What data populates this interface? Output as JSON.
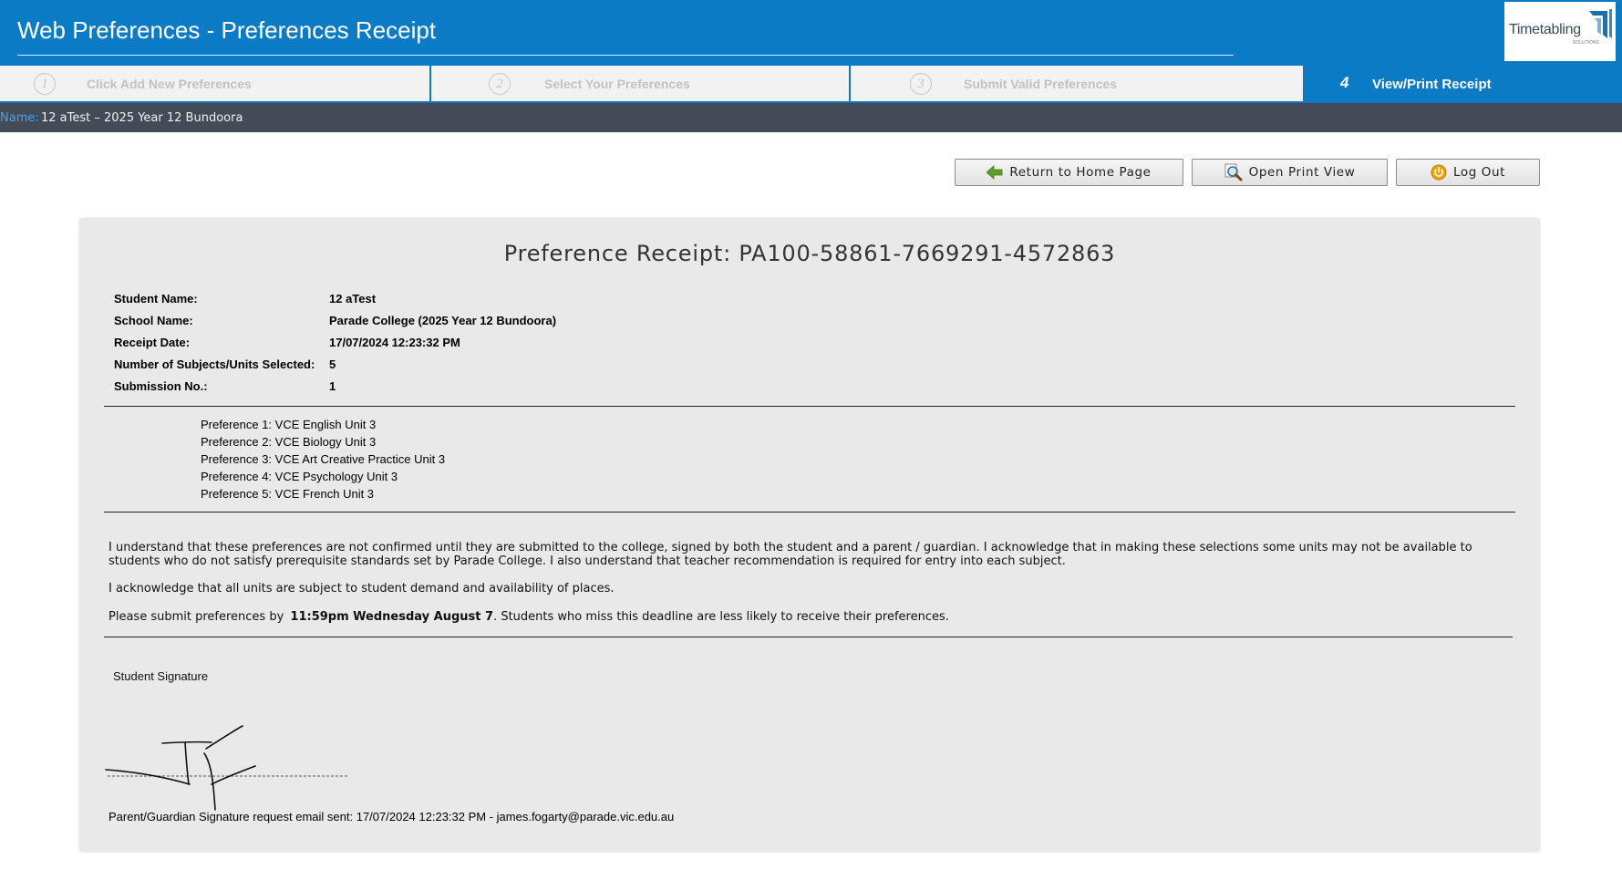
{
  "header": {
    "title": "Web Preferences - Preferences Receipt",
    "logo_text": "Timetabling",
    "logo_sub": "SOLUTIONS"
  },
  "steps": [
    {
      "number": "1",
      "label": "Click Add New Preferences",
      "active": false
    },
    {
      "number": "2",
      "label": "Select Your Preferences",
      "active": false
    },
    {
      "number": "3",
      "label": "Submit Valid Preferences",
      "active": false
    },
    {
      "number": "4",
      "label": "View/Print Receipt",
      "active": true
    }
  ],
  "namebar": {
    "label": "Name:",
    "value": "12 aTest – 2025 Year 12 Bundoora"
  },
  "toolbar": {
    "home_label": "Return to Home Page",
    "print_label": "Open Print View",
    "logout_label": "Log Out",
    "home_icon": "arrow-left-icon",
    "print_icon": "magnifier-icon",
    "logout_icon": "power-icon"
  },
  "receipt": {
    "title": "Preference Receipt: PA100-58861-7669291-4572863",
    "info": [
      {
        "label": "Student Name:",
        "value": "12 aTest"
      },
      {
        "label": "School Name:",
        "value": "Parade College (2025 Year 12 Bundoora)"
      },
      {
        "label": "Receipt Date:",
        "value": "17/07/2024 12:23:32 PM"
      },
      {
        "label": "Number of Subjects/Units Selected:",
        "value": "5"
      },
      {
        "label": "Submission No.:",
        "value": "1"
      }
    ],
    "preferences": [
      "Preference 1: VCE English Unit 3",
      "Preference 2: VCE Biology Unit 3",
      "Preference 3: VCE Art Creative Practice Unit 3",
      "Preference 4: VCE Psychology Unit 3",
      "Preference 5: VCE French Unit 3"
    ],
    "terms_1": "I understand that these preferences are not confirmed until they are submitted to the college, signed by both the student and a parent / guardian.  I acknowledge that in making these selections some units may not be available to students who do not satisfy prerequisite standards set by Parade College. I also understand that teacher recommendation is required for entry into each subject.",
    "terms_2": "I acknowledge that all units are subject to student demand and availability of places.",
    "deadline_prefix": "Please submit preferences by ",
    "deadline_bold": "11:59pm Wednesday August 7",
    "deadline_suffix": ". Students who miss this deadline are less likely to receive their preferences.",
    "signature_label": "Student Signature",
    "email_line": "Parent/Guardian Signature request email sent: 17/07/2024 12:23:32 PM - james.fogarty@parade.vic.edu.au"
  },
  "colors": {
    "header_blue": "#0a7bc4",
    "namebar_bg": "#444a57",
    "panel_bg": "#e9e9e9"
  }
}
